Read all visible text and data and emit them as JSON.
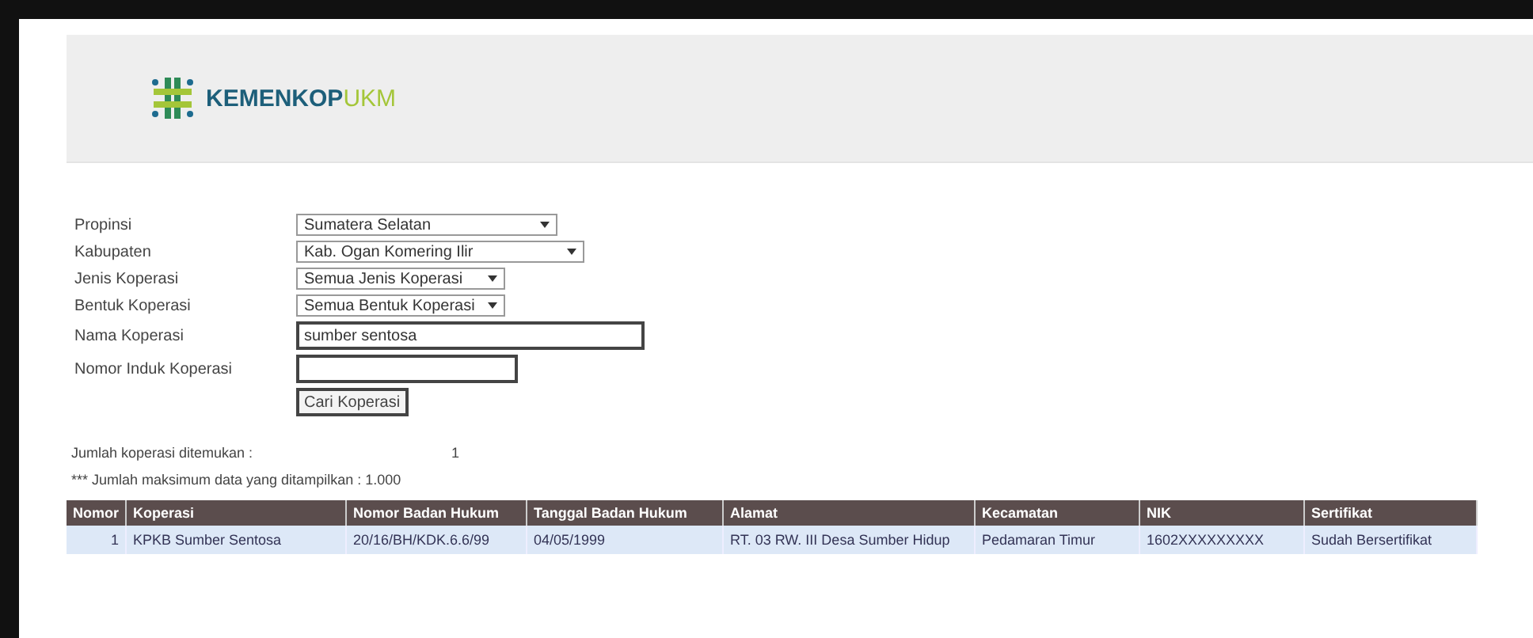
{
  "header": {
    "logo": {
      "main": "KEMENKOP",
      "accent": "UKM"
    }
  },
  "form": {
    "fields": [
      {
        "kind": "select",
        "label": "Propinsi",
        "value": "Sumatera Selatan"
      },
      {
        "kind": "select",
        "label": "Kabupaten",
        "value": "Kab. Ogan Komering Ilir"
      },
      {
        "kind": "select",
        "label": "Jenis Koperasi",
        "value": "Semua Jenis Koperasi"
      },
      {
        "kind": "select",
        "label": "Bentuk Koperasi",
        "value": "Semua Bentuk Koperasi"
      },
      {
        "kind": "text",
        "label": "Nama Koperasi",
        "value": "sumber sentosa"
      },
      {
        "kind": "text",
        "label": "Nomor Induk Koperasi"
      }
    ],
    "button": "Cari Koperasi"
  },
  "summary": {
    "found_label": "Jumlah koperasi ditemukan :",
    "found_value": "1",
    "max_note": "*** Jumlah maksimum data yang ditampilkan : 1.000"
  },
  "table": {
    "columns": [
      "Nomor",
      "Koperasi",
      "Nomor Badan Hukum",
      "Tanggal Badan Hukum",
      "Alamat",
      "Kecamatan",
      "NIK",
      "Sertifikat"
    ],
    "rows": [
      [
        "1",
        "KPKB Sumber Sentosa",
        "20/16/BH/KDK.6.6/99",
        "04/05/1999",
        "RT. 03 RW. III Desa Sumber Hidup",
        "Pedamaran Timur",
        "1602XXXXXXXXX",
        "Sudah Bersertifikat"
      ]
    ]
  }
}
